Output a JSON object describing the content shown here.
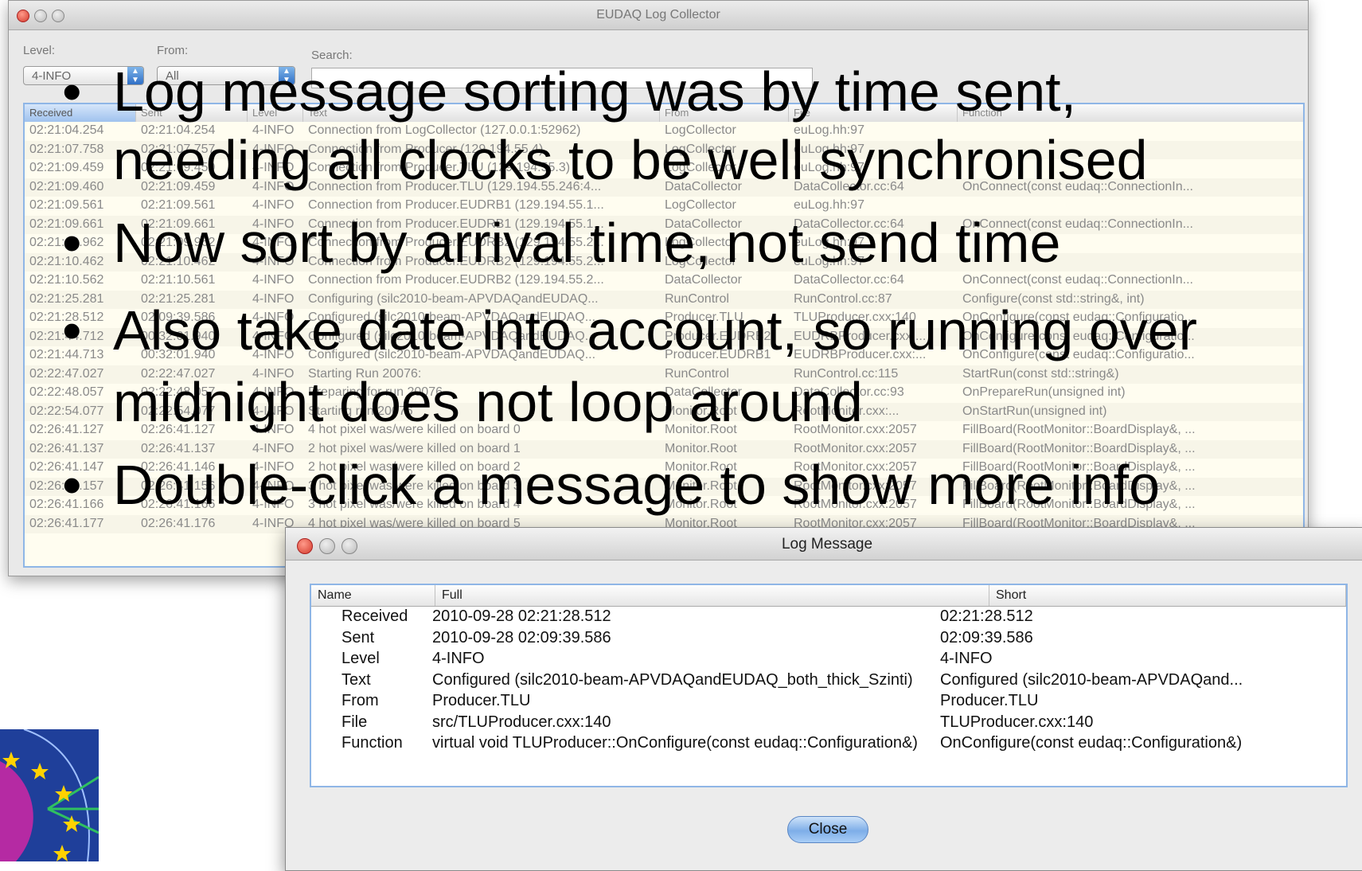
{
  "main_window": {
    "title": "EUDAQ Log Collector",
    "level_label": "Level:",
    "level_value": "4-INFO",
    "from_label": "From:",
    "from_value": "All",
    "search_label": "Search:",
    "search_value": "",
    "columns": [
      "Received",
      "Sent",
      "Level",
      "Text",
      "From",
      "File",
      "Function"
    ],
    "rows": [
      [
        "02:21:04.254",
        "02:21:04.254",
        "4-INFO",
        "Connection from LogCollector (127.0.0.1:52962)",
        "LogCollector",
        "euLog.hh:97",
        ""
      ],
      [
        "02:21:07.758",
        "02:21:07.757",
        "4-INFO",
        "Connection from Producer (129.194.55.4)",
        "LogCollector",
        "euLog.hh:97",
        ""
      ],
      [
        "02:21:09.459",
        "02:21:09.459",
        "4-INFO",
        "Connection from Producer.TLU (129.194.55.3)",
        "LogCollector",
        "euLog.hh:97",
        ""
      ],
      [
        "02:21:09.460",
        "02:21:09.459",
        "4-INFO",
        "Connection from Producer.TLU (129.194.55.246:4...",
        "DataCollector",
        "DataCollector.cc:64",
        "OnConnect(const eudaq::ConnectionIn..."
      ],
      [
        "02:21:09.561",
        "02:21:09.561",
        "4-INFO",
        "Connection from Producer.EUDRB1 (129.194.55.1...",
        "LogCollector",
        "euLog.hh:97",
        ""
      ],
      [
        "02:21:09.661",
        "02:21:09.661",
        "4-INFO",
        "Connection from Producer.EUDRB1 (129.194.55.1...",
        "DataCollector",
        "DataCollector.cc:64",
        "OnConnect(const eudaq::ConnectionIn..."
      ],
      [
        "02:21:09.962",
        "02:21:09.962",
        "4-INFO",
        "Connection from Producer.EUDRB2 (129.194.55.2...",
        "LogCollector",
        "euLog.hh:97",
        ""
      ],
      [
        "02:21:10.462",
        "02:21:10.462",
        "4-INFO",
        "Connection from Producer.EUDRB2 (129.194.55.2...",
        "LogCollector",
        "euLog.hh:97",
        ""
      ],
      [
        "02:21:10.562",
        "02:21:10.561",
        "4-INFO",
        "Connection from Producer.EUDRB2 (129.194.55.2...",
        "DataCollector",
        "DataCollector.cc:64",
        "OnConnect(const eudaq::ConnectionIn..."
      ],
      [
        "02:21:25.281",
        "02:21:25.281",
        "4-INFO",
        "Configuring (silc2010-beam-APVDAQandEUDAQ...",
        "RunControl",
        "RunControl.cc:87",
        "Configure(const std::string&, int)"
      ],
      [
        "02:21:28.512",
        "02:09:39.586",
        "4-INFO",
        "Configured (silc2010-beam-APVDAQandEUDAQ...",
        "Producer.TLU",
        "TLUProducer.cxx:140",
        "OnConfigure(const eudaq::Configuratio..."
      ],
      [
        "02:21:44.712",
        "00:32:01.940",
        "4-INFO",
        "Configured (silc2010-beam-APVDAQandEUDAQ...",
        "Producer.EUDRB2",
        "EUDRBProducer.cxx:...",
        "OnConfigure(const eudaq::Configuratio..."
      ],
      [
        "02:21:44.713",
        "00:32:01.940",
        "4-INFO",
        "Configured (silc2010-beam-APVDAQandEUDAQ...",
        "Producer.EUDRB1",
        "EUDRBProducer.cxx:...",
        "OnConfigure(const eudaq::Configuratio..."
      ],
      [
        "02:22:47.027",
        "02:22:47.027",
        "4-INFO",
        "Starting Run 20076:",
        "RunControl",
        "RunControl.cc:115",
        "StartRun(const std::string&)"
      ],
      [
        "02:22:48.057",
        "02:22:48.057",
        "4-INFO",
        "Preparing for run 20076",
        "DataCollector",
        "DataCollector.cc:93",
        "OnPrepareRun(unsigned int)"
      ],
      [
        "02:22:54.077",
        "02:22:54.077",
        "4-INFO",
        "Starting run 20076",
        "Monitor.Root",
        "RootMonitor.cxx:...",
        "OnStartRun(unsigned int)"
      ],
      [
        "02:26:41.127",
        "02:26:41.127",
        "4-INFO",
        "4 hot pixel was/were killed on board 0",
        "Monitor.Root",
        "RootMonitor.cxx:2057",
        "FillBoard(RootMonitor::BoardDisplay&, ..."
      ],
      [
        "02:26:41.137",
        "02:26:41.137",
        "4-INFO",
        "2 hot pixel was/were killed on board 1",
        "Monitor.Root",
        "RootMonitor.cxx:2057",
        "FillBoard(RootMonitor::BoardDisplay&, ..."
      ],
      [
        "02:26:41.147",
        "02:26:41.146",
        "4-INFO",
        "2 hot pixel was/were killed on board 2",
        "Monitor.Root",
        "RootMonitor.cxx:2057",
        "FillBoard(RootMonitor::BoardDisplay&, ..."
      ],
      [
        "02:26:41.157",
        "02:26:41.156",
        "4-INFO",
        "3 hot pixel was/were killed on board 3",
        "Monitor.Root",
        "RootMonitor.cxx:2057",
        "FillBoard(RootMonitor::BoardDisplay&, ..."
      ],
      [
        "02:26:41.166",
        "02:26:41.166",
        "4-INFO",
        "3 hot pixel was/were killed on board 4",
        "Monitor.Root",
        "RootMonitor.cxx:2057",
        "FillBoard(RootMonitor::BoardDisplay&, ..."
      ],
      [
        "02:26:41.177",
        "02:26:41.176",
        "4-INFO",
        "4 hot pixel was/were killed on board 5",
        "Monitor.Root",
        "RootMonitor.cxx:2057",
        "FillBoard(RootMonitor::BoardDisplay&, ..."
      ]
    ]
  },
  "bullets": [
    "Log message sorting was by time sent,",
    "needing all clocks to be well synchronised",
    "Now sort by arrival time, not send time",
    "Also take date into account, so running over",
    "midnight does not loop around",
    "Double-click a message to show more info"
  ],
  "dialog": {
    "title": "Log Message",
    "columns": [
      "Name",
      "Full",
      "Short"
    ],
    "rows": [
      [
        "Received",
        "2010-09-28 02:21:28.512",
        "02:21:28.512"
      ],
      [
        "Sent",
        "2010-09-28 02:09:39.586",
        "02:09:39.586"
      ],
      [
        "Level",
        "4-INFO",
        "4-INFO"
      ],
      [
        "Text",
        "Configured (silc2010-beam-APVDAQandEUDAQ_both_thick_Szinti)",
        "Configured (silc2010-beam-APVDAQand..."
      ],
      [
        "From",
        "Producer.TLU",
        "Producer.TLU"
      ],
      [
        "File",
        "src/TLUProducer.cxx:140",
        "TLUProducer.cxx:140"
      ],
      [
        "Function",
        "virtual void TLUProducer::OnConfigure(const eudaq::Configuration&)",
        "OnConfigure(const eudaq::Configuration&)"
      ]
    ],
    "close_label": "Close"
  },
  "colors": {
    "selection_blue": "#8fb6e6",
    "close_light": "#d33a2c",
    "logo_blue": "#1f3f9a",
    "logo_star": "#ffd200"
  },
  "icons": [
    "close-light-icon",
    "minimize-light-icon",
    "zoom-light-icon",
    "combo-arrow-icon",
    "eu-flag-logo"
  ]
}
